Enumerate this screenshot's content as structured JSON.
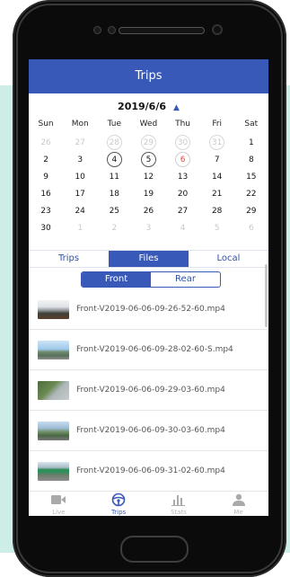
{
  "header": {
    "title": "Trips"
  },
  "calendar": {
    "month_label": "2019/6/6",
    "weekdays": [
      "Sun",
      "Mon",
      "Tue",
      "Wed",
      "Thu",
      "Fri",
      "Sat"
    ],
    "weeks": [
      [
        {
          "d": "26",
          "s": "muted"
        },
        {
          "d": "27",
          "s": "muted"
        },
        {
          "d": "28",
          "s": "dim"
        },
        {
          "d": "29",
          "s": "dim"
        },
        {
          "d": "30",
          "s": "dim"
        },
        {
          "d": "31",
          "s": "dim"
        },
        {
          "d": "1",
          "s": "normal"
        }
      ],
      [
        {
          "d": "2",
          "s": "normal"
        },
        {
          "d": "3",
          "s": "normal"
        },
        {
          "d": "4",
          "s": "active"
        },
        {
          "d": "5",
          "s": "active"
        },
        {
          "d": "6",
          "s": "today"
        },
        {
          "d": "7",
          "s": "normal"
        },
        {
          "d": "8",
          "s": "normal"
        }
      ],
      [
        {
          "d": "9",
          "s": "normal"
        },
        {
          "d": "10",
          "s": "normal"
        },
        {
          "d": "11",
          "s": "normal"
        },
        {
          "d": "12",
          "s": "normal"
        },
        {
          "d": "13",
          "s": "normal"
        },
        {
          "d": "14",
          "s": "normal"
        },
        {
          "d": "15",
          "s": "normal"
        }
      ],
      [
        {
          "d": "16",
          "s": "normal"
        },
        {
          "d": "17",
          "s": "normal"
        },
        {
          "d": "18",
          "s": "normal"
        },
        {
          "d": "19",
          "s": "normal"
        },
        {
          "d": "20",
          "s": "normal"
        },
        {
          "d": "21",
          "s": "normal"
        },
        {
          "d": "22",
          "s": "normal"
        }
      ],
      [
        {
          "d": "23",
          "s": "normal"
        },
        {
          "d": "24",
          "s": "normal"
        },
        {
          "d": "25",
          "s": "normal"
        },
        {
          "d": "26",
          "s": "normal"
        },
        {
          "d": "27",
          "s": "normal"
        },
        {
          "d": "28",
          "s": "normal"
        },
        {
          "d": "29",
          "s": "normal"
        }
      ],
      [
        {
          "d": "30",
          "s": "normal"
        },
        {
          "d": "1",
          "s": "muted"
        },
        {
          "d": "2",
          "s": "muted"
        },
        {
          "d": "3",
          "s": "muted"
        },
        {
          "d": "4",
          "s": "muted"
        },
        {
          "d": "5",
          "s": "muted"
        },
        {
          "d": "6",
          "s": "muted"
        }
      ]
    ]
  },
  "tabs": [
    {
      "label": "Trips",
      "active": false
    },
    {
      "label": "Files",
      "active": true
    },
    {
      "label": "Local",
      "active": false
    }
  ],
  "segment": [
    {
      "label": "Front",
      "active": true
    },
    {
      "label": "Rear",
      "active": false
    }
  ],
  "files": [
    {
      "name": "Front-V2019-06-06-09-26-52-60.mp4",
      "thumb": "t1"
    },
    {
      "name": "Front-V2019-06-06-09-28-02-60-S.mp4",
      "thumb": "t2"
    },
    {
      "name": "Front-V2019-06-06-09-29-03-60.mp4",
      "thumb": "t3"
    },
    {
      "name": "Front-V2019-06-06-09-30-03-60.mp4",
      "thumb": "t4"
    },
    {
      "name": "Front-V2019-06-06-09-31-02-60.mp4",
      "thumb": "t5"
    }
  ],
  "nav": [
    {
      "label": "Live",
      "icon": "video-camera-icon",
      "active": false
    },
    {
      "label": "Trips",
      "icon": "steering-wheel-icon",
      "active": true
    },
    {
      "label": "Stats",
      "icon": "bar-chart-icon",
      "active": false
    },
    {
      "label": "Me",
      "icon": "person-icon",
      "active": false
    }
  ],
  "colors": {
    "accent": "#3859b7",
    "today": "#e04a3a",
    "muted": "#c9c9c9"
  }
}
